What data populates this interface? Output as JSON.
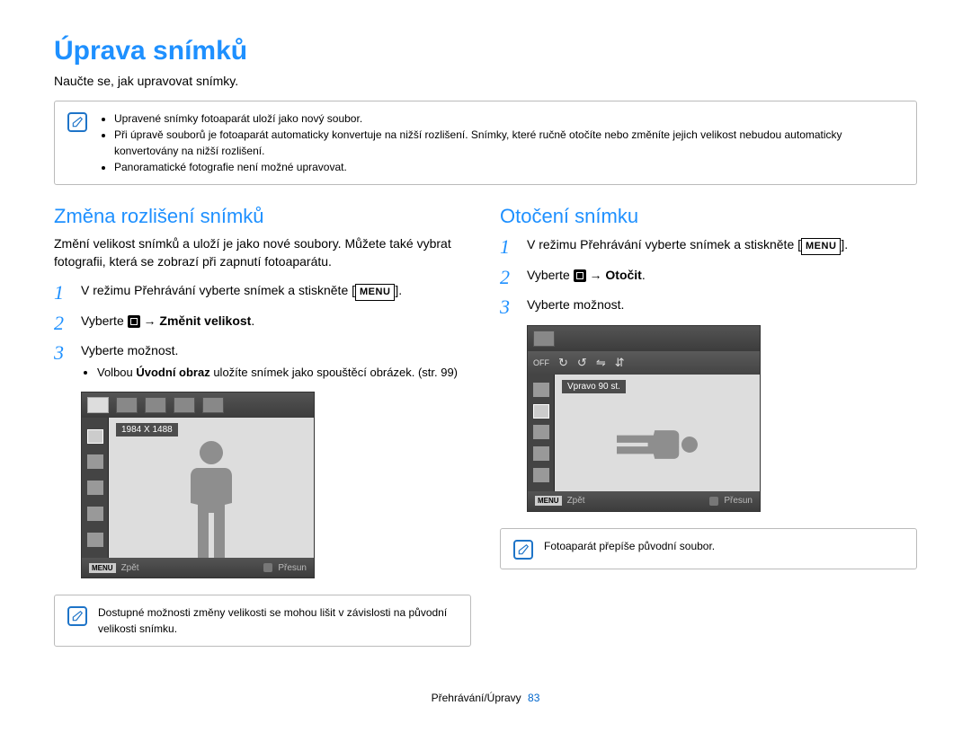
{
  "title": "Úprava snímků",
  "subtitle": "Naučte se, jak upravovat snímky.",
  "top_note": {
    "items": [
      "Upravené snímky fotoaparát uloží jako nový soubor.",
      "Při úpravě souborů je fotoaparát automaticky konvertuje na nižší rozlišení. Snímky, které ručně otočíte nebo změníte jejich velikost nebudou automaticky konvertovány na nižší rozlišení.",
      "Panoramatické fotografie není možné upravovat."
    ]
  },
  "left": {
    "heading": "Změna rozlišení snímků",
    "desc": "Změní velikost snímků a uloží je jako nové soubory. Můžete také vybrat fotografii, která se zobrazí při zapnutí fotoaparátu.",
    "steps": {
      "s1_pre": "V režimu Přehrávání vyberte snímek a stiskněte [",
      "s1_menu": "MENU",
      "s1_post": "].",
      "s2_pre": "Vyberte ",
      "s2_arrow": " → ",
      "s2_bold": "Změnit velikost",
      "s2_post": ".",
      "s3": "Vyberte možnost.",
      "s3_bullet_pre": "Volbou ",
      "s3_bullet_bold": "Úvodní obraz",
      "s3_bullet_post": " uložíte snímek jako spouštěcí obrázek. (str. 99)"
    },
    "camera": {
      "label": "1984 X 1488",
      "back": "Zpět",
      "move": "Přesun",
      "menu_tag": "MENU"
    },
    "bottom_note": "Dostupné možnosti změny velikosti se mohou lišit v závislosti na původní velikosti snímku."
  },
  "right": {
    "heading": "Otočení snímku",
    "steps": {
      "s1_pre": "V režimu Přehrávání vyberte snímek a stiskněte [",
      "s1_menu": "MENU",
      "s1_post": "].",
      "s2_pre": "Vyberte ",
      "s2_arrow": " → ",
      "s2_bold": "Otočit",
      "s2_post": ".",
      "s3": "Vyberte možnost."
    },
    "camera": {
      "off": "OFF",
      "label": "Vpravo 90 st.",
      "back": "Zpět",
      "move": "Přesun",
      "menu_tag": "MENU"
    },
    "bottom_note": "Fotoaparát přepíše původní soubor."
  },
  "footer": {
    "section": "Přehrávání/Úpravy",
    "page": "83"
  }
}
